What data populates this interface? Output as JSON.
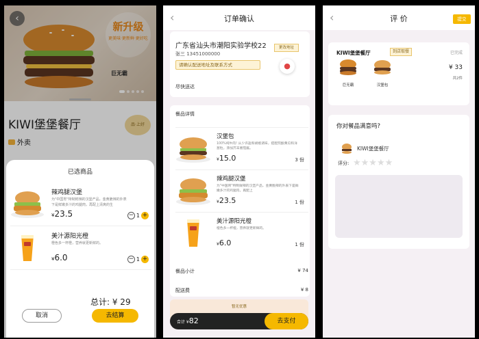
{
  "screen1": {
    "promo_big": "新升级",
    "promo_small": "更美味·更新鲜·更好吃",
    "banner_burger_name": "巨无霸",
    "shop_title": "KIWI堡堡餐厅",
    "seal_text": "品·上好",
    "tag_label": "外卖",
    "sheet_title": "已选商品",
    "items": [
      {
        "name": "辣鸡腿汉堡",
        "desc": "为\"中国胃\"特制鲜辣的汉堡产品，金黄脆辣的外表下是鲜嫩多汁的鸡腿肉，再配上清爽的生",
        "currency": "¥",
        "price": "23.5",
        "qty": "1"
      },
      {
        "name": "美汁源阳光橙",
        "desc": "橙色多一杯橙，营养就更新鲜的。",
        "currency": "¥",
        "price": "6.0",
        "qty": "1"
      }
    ],
    "total_label": "总计: ¥ 29",
    "cancel": "取消",
    "checkout": "去结算"
  },
  "screen2": {
    "title": "订单确认",
    "address": "广东省汕头市潮阳实验学校22",
    "contact": "张三  13451000000",
    "hint": "请确认配送地址及联系方式",
    "change_address": "更改地址",
    "delivery": "尽快送达",
    "section": "餐品详情",
    "items": [
      {
        "name": "汉堡包",
        "desc": "100%纯牛肉! 从少许盐和胡椒调味，搭配煎酸黄瓜和洋葱粒，添加芥末番茄酱。",
        "currency": "¥",
        "price": "15.0",
        "qty": "3 份"
      },
      {
        "name": "辣鸡腿汉堡",
        "desc": "为\"中国胃\"特制鲜辣的汉堡产品，金黄脆辣的外表下是鲜嫩多汁的鸡腿肉，再配上",
        "currency": "¥",
        "price": "23.5",
        "qty": "1 份"
      },
      {
        "name": "美汁源阳光橙",
        "desc": "橙色多一杯橙，营养就更新鲜的。",
        "currency": "¥",
        "price": "6.0",
        "qty": "1 份"
      }
    ],
    "subtotal_label": "餐品小计",
    "subtotal_value": "¥ 74",
    "delivery_fee_label": "配送费",
    "delivery_fee_value": "¥ 8",
    "discount": "暂无优惠",
    "pay_prefix": "合计 ¥",
    "pay_amount": "82",
    "pay_button": "去支付"
  },
  "screen3": {
    "title": "评 价",
    "submit": "提交",
    "shop": "KIWI堡堡餐厅",
    "pickup": "到店取餐",
    "status": "已完成",
    "mini_items": [
      "巨无霸",
      "汉堡包"
    ],
    "price": "¥ 33",
    "count": "共2件",
    "question": "你对餐品满意吗?",
    "shop2": "KIWI堡堡餐厅",
    "score_label": "评分:",
    "stars": "★★★★★"
  }
}
